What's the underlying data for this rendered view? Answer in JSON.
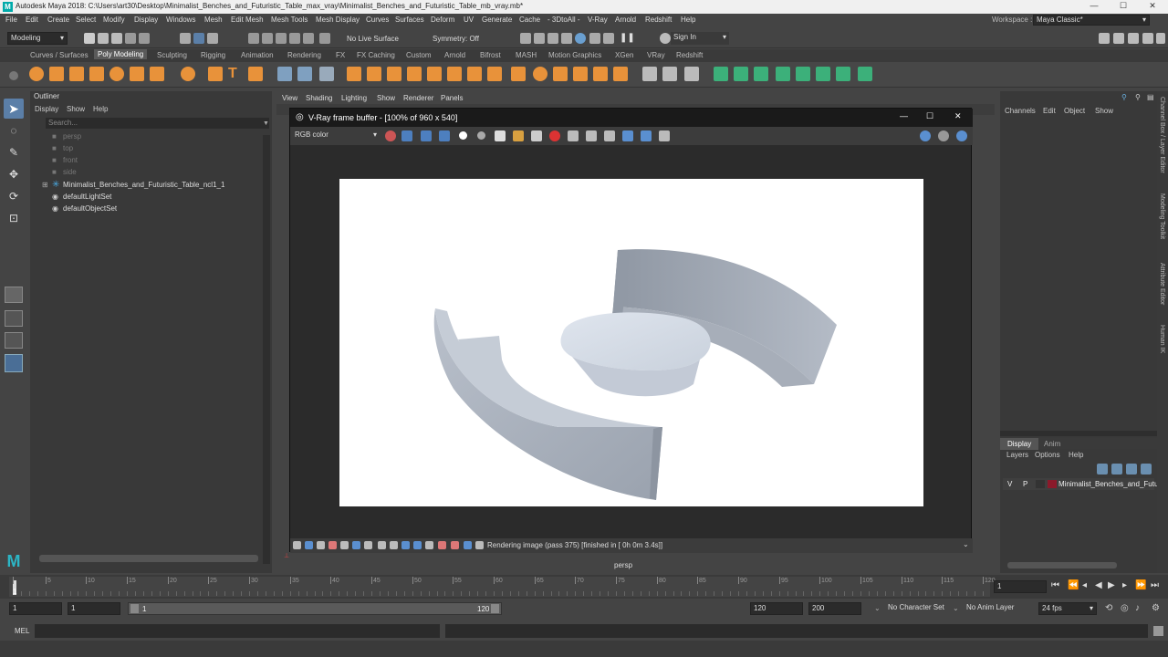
{
  "app": {
    "title": "Autodesk Maya 2018: C:\\Users\\art30\\Desktop\\Minimalist_Benches_and_Futuristic_Table_max_vray\\Minimalist_Benches_and_Futuristic_Table_mb_vray.mb*",
    "logo": "M"
  },
  "menubar": [
    "File",
    "Edit",
    "Create",
    "Select",
    "Modify",
    "Display",
    "Windows",
    "Mesh",
    "Edit Mesh",
    "Mesh Tools",
    "Mesh Display",
    "Curves",
    "Surfaces",
    "Deform",
    "UV",
    "Generate",
    "Cache",
    "- 3DtoAll -",
    "V-Ray",
    "Arnold",
    "Redshift",
    "Help"
  ],
  "workspace": {
    "label": "Workspace :",
    "value": "Maya Classic*"
  },
  "statusline": {
    "mode": "Modeling",
    "live_surface": "No Live Surface",
    "symmetry": "Symmetry: Off",
    "sign_in": "Sign In"
  },
  "shelf_tabs": [
    "Curves / Surfaces",
    "Poly Modeling",
    "Sculpting",
    "Rigging",
    "Animation",
    "Rendering",
    "FX",
    "FX Caching",
    "Custom",
    "Arnold",
    "Bifrost",
    "MASH",
    "Motion Graphics",
    "XGen",
    "VRay",
    "Redshift"
  ],
  "shelf_active": "Poly Modeling",
  "outliner": {
    "title": "Outliner",
    "menu": [
      "Display",
      "Show",
      "Help"
    ],
    "search_placeholder": "Search...",
    "items": [
      {
        "label": "persp",
        "dim": true
      },
      {
        "label": "top",
        "dim": true
      },
      {
        "label": "front",
        "dim": true
      },
      {
        "label": "side",
        "dim": true
      },
      {
        "label": "Minimalist_Benches_and_Futuristic_Table_ncl1_1",
        "dim": false
      },
      {
        "label": "defaultLightSet",
        "dim": false
      },
      {
        "label": "defaultObjectSet",
        "dim": false
      }
    ]
  },
  "viewport": {
    "menu": [
      "View",
      "Shading",
      "Lighting",
      "Show",
      "Renderer",
      "Panels"
    ],
    "camera": "persp"
  },
  "vray": {
    "title": "V-Ray frame buffer - [100% of 960 x 540]",
    "channel": "RGB color",
    "status": "Rendering image (pass 375) [finished in [ 0h  0m  3.4s]]"
  },
  "channelbox": {
    "menu": [
      "Channels",
      "Edit",
      "Object",
      "Show"
    ],
    "layer_tabs": [
      "Display",
      "Anim"
    ],
    "layer_menu": [
      "Layers",
      "Options",
      "Help"
    ],
    "layer": {
      "v": "V",
      "p": "P",
      "name": "Minimalist_Benches_and_Futur"
    }
  },
  "side_tabs": [
    "Channel Box / Layer Editor",
    "Modeling Toolkit",
    "Attribute Editor",
    "Human IK"
  ],
  "timeline": {
    "ticks": [
      "1",
      "5",
      "10",
      "15",
      "20",
      "25",
      "30",
      "35",
      "40",
      "45",
      "50",
      "55",
      "60",
      "65",
      "70",
      "75",
      "80",
      "85",
      "90",
      "95",
      "100",
      "105",
      "110",
      "115",
      "120"
    ],
    "current_frame": "1"
  },
  "range": {
    "start": "1",
    "start2": "1",
    "slider_start": "1",
    "slider_end": "120",
    "end": "120",
    "anim_end": "200",
    "character_set": "No Character Set",
    "anim_layer": "No Anim Layer",
    "fps": "24 fps"
  },
  "mel": {
    "label": "MEL"
  }
}
